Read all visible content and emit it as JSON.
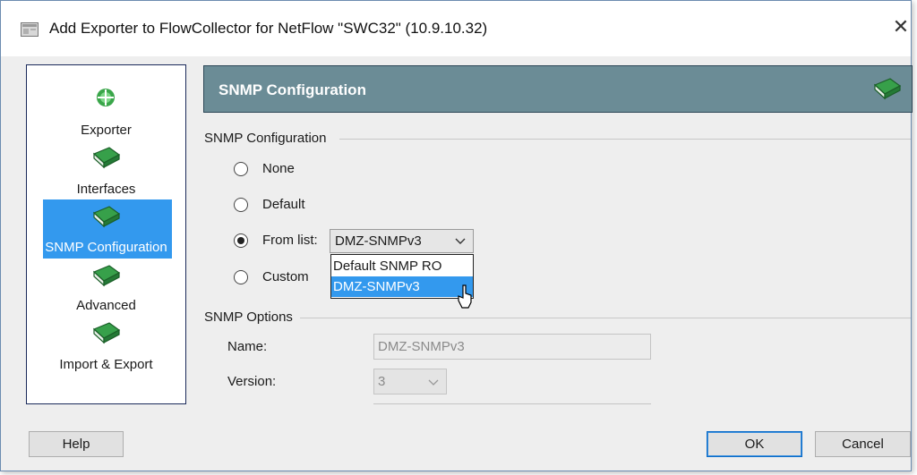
{
  "window": {
    "title": "Add Exporter to FlowCollector for NetFlow \"SWC32\" (10.9.10.32)",
    "close_glyph": "✕"
  },
  "nav": {
    "items": [
      {
        "label": "Exporter",
        "icon": "exporter-icon"
      },
      {
        "label": "Interfaces",
        "icon": "book-icon"
      },
      {
        "label": "SNMP Configuration",
        "icon": "book-icon",
        "selected": true
      },
      {
        "label": "Advanced",
        "icon": "book-icon"
      },
      {
        "label": "Import & Export",
        "icon": "book-icon"
      }
    ]
  },
  "header": {
    "title": "SNMP Configuration",
    "icon": "book-icon"
  },
  "snmp_config": {
    "group_label": "SNMP Configuration",
    "options": [
      {
        "label": "None",
        "checked": false
      },
      {
        "label": "Default",
        "checked": false
      },
      {
        "label": "From list:",
        "checked": true
      },
      {
        "label": "Custom",
        "checked": false
      }
    ],
    "combo_value": "DMZ-SNMPv3",
    "dropdown_options": [
      "Default SNMP RO",
      "DMZ-SNMPv3"
    ],
    "dropdown_selected_index": 1
  },
  "snmp_options": {
    "group_label": "SNMP Options",
    "name_label": "Name:",
    "name_value": "DMZ-SNMPv3",
    "version_label": "Version:",
    "version_value": "3"
  },
  "buttons": {
    "help": "Help",
    "ok": "OK",
    "cancel": "Cancel"
  },
  "colors": {
    "header_bg": "#6b8c96",
    "selection": "#3399ee",
    "book_green": "#2e8b3e"
  }
}
